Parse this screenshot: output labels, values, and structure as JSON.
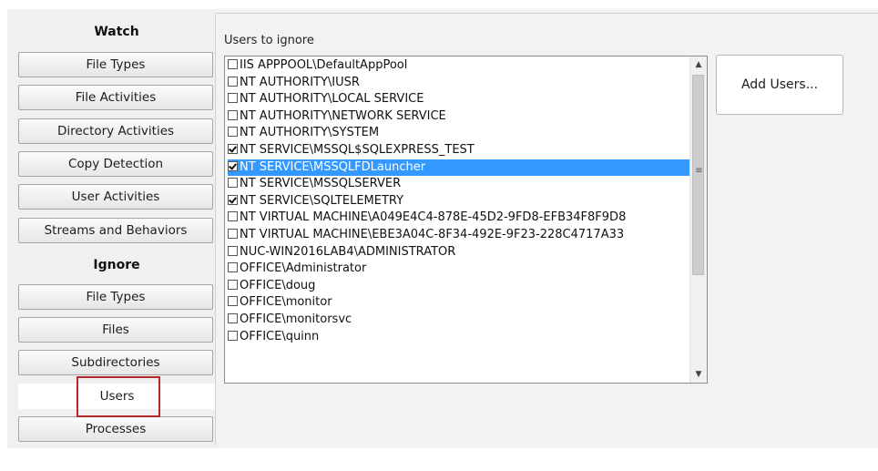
{
  "sidebar": {
    "watch_label": "Watch",
    "watch_items": [
      {
        "label": "File Types"
      },
      {
        "label": "File Activities"
      },
      {
        "label": "Directory Activities"
      },
      {
        "label": "Copy Detection"
      },
      {
        "label": "User Activities"
      },
      {
        "label": "Streams and Behaviors"
      }
    ],
    "ignore_label": "Ignore",
    "ignore_items": [
      {
        "label": "File Types"
      },
      {
        "label": "Files"
      },
      {
        "label": "Subdirectories"
      },
      {
        "label": "Users",
        "selected": true
      },
      {
        "label": "Processes"
      }
    ]
  },
  "main": {
    "title": "Users to ignore",
    "add_button_label": "Add Users...",
    "users": [
      {
        "name": "IIS APPPOOL\\DefaultAppPool",
        "checked": false
      },
      {
        "name": "NT AUTHORITY\\IUSR",
        "checked": false
      },
      {
        "name": "NT AUTHORITY\\LOCAL SERVICE",
        "checked": false
      },
      {
        "name": "NT AUTHORITY\\NETWORK SERVICE",
        "checked": false
      },
      {
        "name": "NT AUTHORITY\\SYSTEM",
        "checked": false
      },
      {
        "name": "NT SERVICE\\MSSQL$SQLEXPRESS_TEST",
        "checked": true
      },
      {
        "name": "NT SERVICE\\MSSQLFDLauncher",
        "checked": true,
        "selected": true
      },
      {
        "name": "NT SERVICE\\MSSQLSERVER",
        "checked": false
      },
      {
        "name": "NT SERVICE\\SQLTELEMETRY",
        "checked": true
      },
      {
        "name": "NT VIRTUAL MACHINE\\A049E4C4-878E-45D2-9FD8-EFB34F8F9D8",
        "checked": false
      },
      {
        "name": "NT VIRTUAL MACHINE\\EBE3A04C-8F34-492E-9F23-228C4717A33",
        "checked": false
      },
      {
        "name": "NUC-WIN2016LAB4\\ADMINISTRATOR",
        "checked": false
      },
      {
        "name": "OFFICE\\Administrator",
        "checked": false
      },
      {
        "name": "OFFICE\\doug",
        "checked": false
      },
      {
        "name": "OFFICE\\monitor",
        "checked": false
      },
      {
        "name": "OFFICE\\monitorsvc",
        "checked": false
      },
      {
        "name": "OFFICE\\quinn",
        "checked": false
      }
    ],
    "scrollbar": {
      "up_icon": "▲",
      "down_icon": "▼",
      "grip_icon": "≡"
    }
  },
  "colors": {
    "selection": "#3399ff",
    "highlight_border": "#b32929"
  }
}
